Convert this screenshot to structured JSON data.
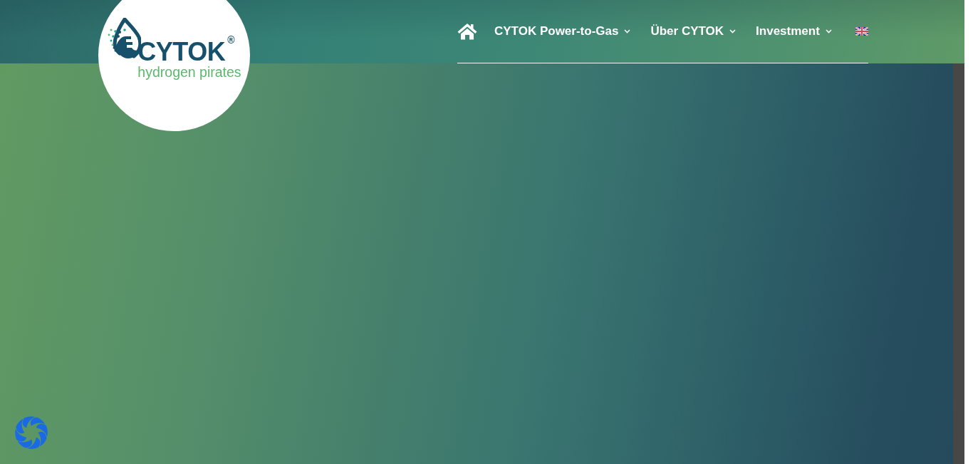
{
  "header": {
    "logo": {
      "name": "CYTOK",
      "mark": "®",
      "tagline": "hydrogen pirates"
    },
    "nav": [
      {
        "label": "CYTOK Power-to-Gas",
        "submenu": true
      },
      {
        "label": "Über CYTOK",
        "submenu": true
      },
      {
        "label": "Investment",
        "submenu": true
      }
    ]
  }
}
